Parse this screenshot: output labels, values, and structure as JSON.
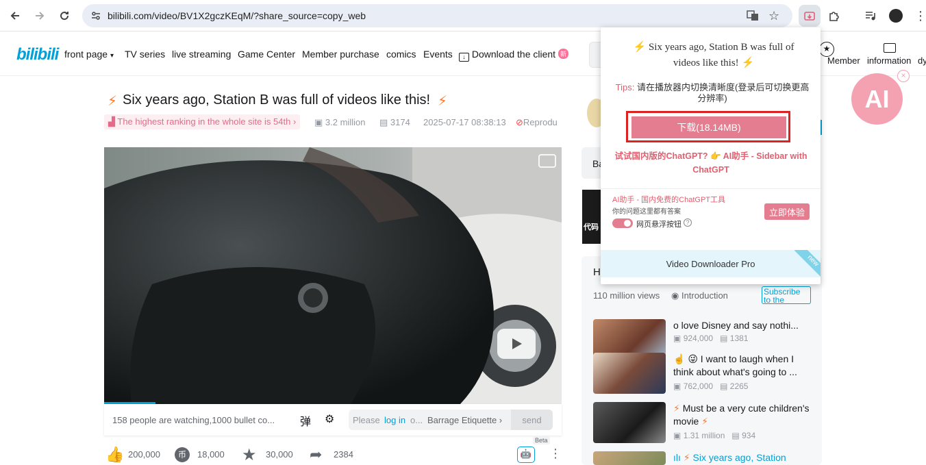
{
  "browser": {
    "url": "bilibili.com/video/BV1X2gczKEqM/?share_source=copy_web"
  },
  "nav": {
    "logo": "bilibili",
    "front_page": "front page",
    "tv_series": "TV series",
    "live_streaming": "live streaming",
    "game_center": "Game Center",
    "member_purchase": "Member purchase",
    "comics": "comics",
    "events": "Events",
    "download_client": "Download the client",
    "new_badge": "新",
    "member": "Member",
    "information": "information",
    "dy": "dy"
  },
  "video": {
    "title": "Six years ago, Station B was full of videos like this!",
    "ranking": "The highest ranking in the whole site is 54th",
    "views": "3.2 million",
    "danmaku_count": "3174",
    "date": "2025-07-17 08:38:13",
    "reproduction": "Reprodu"
  },
  "danmaku_bar": {
    "watching": "158  people are watching,1000 bullet co...",
    "placeholder_pre": "Please",
    "login": "log in",
    "placeholder_post": "o...",
    "etiquette": "Barrage Etiquette",
    "send": "send"
  },
  "toolbar": {
    "likes": "200,000",
    "coins": "18,000",
    "favorites": "30,000",
    "shares": "2384",
    "beta": "Beta"
  },
  "sidebar": {
    "ba": "Ba",
    "code_text": "代码",
    "h": "H",
    "collection_views": "110 million views",
    "introduction": "Introduction",
    "subscribe": "Subscribe to the collection"
  },
  "recommendations": [
    {
      "title": "o love Disney and say nothi...",
      "views": "924,000",
      "comments": "1381"
    },
    {
      "title": "☝️ 😜 I want to laugh when I think about what's going to ...",
      "views": "762,000",
      "comments": "2265"
    },
    {
      "title": "Must be a very cute children's movie",
      "views": "1.31 million",
      "comments": "934"
    },
    {
      "title": "Six years ago, Station",
      "views": "",
      "comments": ""
    }
  ],
  "popup": {
    "title": "Six years ago, Station B was full of videos like this!",
    "tips_label": "Tips:",
    "tips_text": "请在播放器内切换清晰度(登录后可切换更高分辨率)",
    "download_btn": "下载(18.14MB)",
    "promo": "试试国内版的ChatGPT? 👉 AI助手 - Sidebar with ChatGPT",
    "ai_title": "AI助手 - 国内免费的ChatGPT工具",
    "ai_sub": "你的问题这里都有答案",
    "toggle_label": "网页悬浮按钮",
    "try_btn": "立即体验",
    "vdp": "Video Downloader Pro",
    "new_ribbon": "new"
  },
  "ai_float": {
    "label": "AI"
  },
  "colors": {
    "bili_blue": "#00a1d6",
    "bili_pink": "#fb7299",
    "accent_red": "#d22"
  }
}
